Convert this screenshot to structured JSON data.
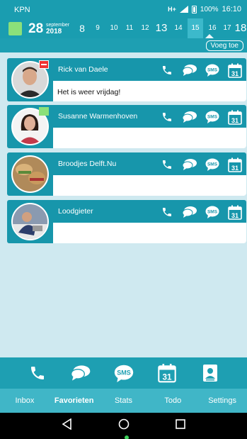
{
  "status": {
    "carrier": "KPN",
    "network": "H+",
    "battery": "100%",
    "time": "16:10"
  },
  "date": {
    "day": "28",
    "month": "september",
    "year": "2018"
  },
  "hours": [
    "8",
    "9",
    "10",
    "11",
    "12",
    "13",
    "14",
    "15",
    "16",
    "17",
    "18"
  ],
  "toolbar": {
    "add_label": "Voeg toe"
  },
  "favorites": [
    {
      "name": "Rick van Daele",
      "message": "Het is weer vrijdag!",
      "status": "red"
    },
    {
      "name": "Susanne Warmenhoven",
      "message": "",
      "status": "green"
    },
    {
      "name": "Broodjes Delft.Nu",
      "message": "",
      "status": ""
    },
    {
      "name": "Loodgieter",
      "message": "",
      "status": ""
    }
  ],
  "icon_labels": {
    "sms": "SMS",
    "calendar": "31"
  },
  "tabs": [
    "Inbox",
    "Favorieten",
    "Stats",
    "Todo",
    "Settings"
  ],
  "active_tab": "Favorieten",
  "colors": {
    "primary": "#1a9db0",
    "card": "#1796ab",
    "tabbar": "#40b6c7",
    "accent_green": "#8be07a",
    "accent_red": "#e33333"
  }
}
